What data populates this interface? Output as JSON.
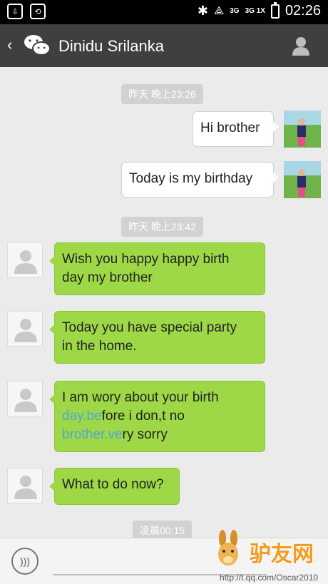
{
  "status_bar": {
    "network_1": "3G",
    "network_2": "3G 1X",
    "time": "02:26"
  },
  "header": {
    "title": "Dinidu Srilanka"
  },
  "chat": {
    "timestamps": [
      "昨天 晚上23:26",
      "昨天 晚上23:42",
      "凌晨00:15"
    ],
    "messages": [
      {
        "from": "me",
        "text": "Hi brother"
      },
      {
        "from": "me",
        "text": "Today is my birthday"
      },
      {
        "from": "them",
        "line1": "Wish you happy happy birth",
        "line2": "day my brother"
      },
      {
        "from": "them",
        "line1": "Today you have special party",
        "line2": "in the home."
      },
      {
        "from": "them",
        "line1": "I am wory about your birth",
        "line2a": "day.be",
        "line2b": "fore i don,t no",
        "line3a": "brother.ve",
        "line3b": "ry sorry"
      },
      {
        "from": "them",
        "text": "What to do now?"
      }
    ]
  },
  "watermark": {
    "text": "驴友网",
    "url": "http://t.qq.com/Oscar2010"
  },
  "colors": {
    "header_bg": "#3f3f41",
    "incoming_bubble": "#9ed846",
    "link_blue": "#4aa9d8"
  }
}
